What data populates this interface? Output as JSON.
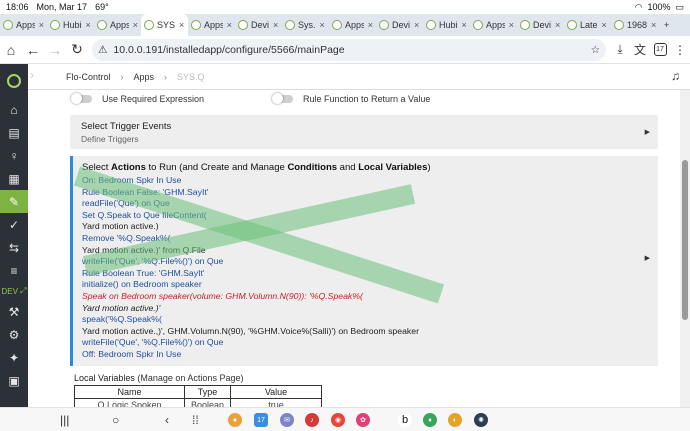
{
  "status": {
    "time": "18:06",
    "date": "Mon, Mar 17",
    "temp": "69°",
    "battery": "100%"
  },
  "tabs": [
    {
      "label": "Apps",
      "active": false
    },
    {
      "label": "Hubi",
      "active": false
    },
    {
      "label": "Apps",
      "active": false
    },
    {
      "label": "SYS",
      "active": true
    },
    {
      "label": "Apps",
      "active": false
    },
    {
      "label": "Devi",
      "active": false
    },
    {
      "label": "Sys.",
      "active": false
    },
    {
      "label": "Apps",
      "active": false
    },
    {
      "label": "Devi",
      "active": false
    },
    {
      "label": "Hubi",
      "active": false
    },
    {
      "label": "Apps",
      "active": false
    },
    {
      "label": "Devi",
      "active": false
    },
    {
      "label": "Late",
      "active": false
    },
    {
      "label": "1968",
      "active": false
    }
  ],
  "addressbar": {
    "url": "10.0.0.191/installedapp/configure/5566/mainPage",
    "tab_count": "17"
  },
  "breadcrumb": {
    "root": "Flo-Control",
    "section": "Apps",
    "current": "SYS.Q"
  },
  "sidenav": {
    "dev_label": "DEV"
  },
  "toggles": {
    "required_expression": "Use Required Expression",
    "rule_function": "Rule Function to Return a Value"
  },
  "trigger": {
    "title": "Select Trigger Events",
    "subtitle": "Define Triggers"
  },
  "actions": {
    "head_parts": [
      "Select ",
      "Actions",
      " to Run (and Create and Manage ",
      "Conditions",
      " and ",
      "Local Variables",
      ")"
    ],
    "lines": [
      {
        "text": "On: Bedroom Spkr In Use",
        "style": "blue"
      },
      {
        "text": "Rule Boolean False: 'GHM.SayIt'",
        "style": "blue"
      },
      {
        "text": "readFile('Que') on Que",
        "style": "blue"
      },
      {
        "text": "Set Q.Speak to Que fileContent(",
        "style": "blue"
      },
      {
        "text": "Yard motion active.)",
        "style": "dark"
      },
      {
        "text": "Remove '%Q.Speak%(",
        "style": "blue"
      },
      {
        "text": "Yard motion active.)' from Q.File",
        "style": "dark"
      },
      {
        "text": "writeFile('Que', '%Q.File%()') on Que",
        "style": "blue"
      },
      {
        "text": "Rule Boolean True: 'GHM.SayIt'",
        "style": "blue"
      },
      {
        "text": "initialize() on Bedroom speaker",
        "style": "blue"
      },
      {
        "text": "Speak on Bedroom speaker(volume: GHM.Volumn.N(90)): '%Q.Speak%(",
        "style": "red"
      },
      {
        "text": "Yard motion active.)'",
        "style": "darkital"
      },
      {
        "text": "speak('%Q.Speak%(",
        "style": "blue"
      },
      {
        "text": "Yard motion active.,)', GHM.Volumn.N(90), '%GHM.Voice%(Salli)') on Bedroom speaker",
        "style": "dark"
      },
      {
        "text": "writeFile('Que', '%Q.File%()') on Que",
        "style": "blue"
      },
      {
        "text": "Off: Bedroom Spkr In Use",
        "style": "blue"
      }
    ]
  },
  "local_vars": {
    "title": "Local Variables",
    "subtitle": "(Manage on Actions Page)",
    "columns": [
      "Name",
      "Type",
      "Value"
    ],
    "rows": [
      [
        "Q.Logic.Spoken",
        "Boolean",
        "true"
      ]
    ]
  },
  "colors": {
    "accent": "#7cb342",
    "sidebar": "#2c3138",
    "action_bar": "#2c8ad6",
    "link_blue": "#1f4f9c",
    "error_red": "#c0222c"
  }
}
